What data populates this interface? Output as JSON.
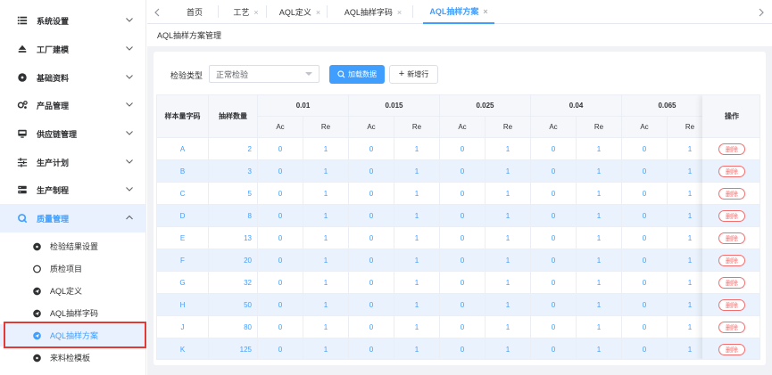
{
  "sidebar": {
    "menus": [
      {
        "label": "系统设置",
        "icon": "list-icon",
        "expanded": false
      },
      {
        "label": "工厂建模",
        "icon": "eject-icon",
        "expanded": false
      },
      {
        "label": "基础资料",
        "icon": "disc-icon",
        "expanded": false
      },
      {
        "label": "产品管理",
        "icon": "gears-icon",
        "expanded": false
      },
      {
        "label": "供应链管理",
        "icon": "monitor-icon",
        "expanded": false
      },
      {
        "label": "生产计划",
        "icon": "sliders-icon",
        "expanded": false
      },
      {
        "label": "生产制程",
        "icon": "server-icon",
        "expanded": false
      },
      {
        "label": "质量管理",
        "icon": "q-icon",
        "expanded": true
      }
    ],
    "sub_items": [
      {
        "label": "检验结果设置",
        "icon": "disc-icon",
        "active": false
      },
      {
        "label": "质检项目",
        "icon": "ring-icon",
        "active": false
      },
      {
        "label": "AQL定义",
        "icon": "send-icon",
        "active": false
      },
      {
        "label": "AQL抽样字码",
        "icon": "send-icon",
        "active": false
      },
      {
        "label": "AQL抽样方案",
        "icon": "send-icon",
        "active": true
      },
      {
        "label": "来料检模板",
        "icon": "disc-icon",
        "active": false
      }
    ]
  },
  "tabs": [
    {
      "label": "首页",
      "closable": false,
      "active": false
    },
    {
      "label": "工艺",
      "closable": true,
      "active": false
    },
    {
      "label": "AQL定义",
      "closable": true,
      "active": false
    },
    {
      "label": "AQL抽样字码",
      "closable": true,
      "active": false
    },
    {
      "label": "AQL抽样方案",
      "closable": true,
      "active": true
    }
  ],
  "breadcrumb": "AQL抽样方案管理",
  "filter": {
    "label": "检验类型",
    "value": "正常检验",
    "load_button": "加载数据",
    "add_button": "新增行"
  },
  "table": {
    "col_sample_code": "样本量字码",
    "col_sample_size": "抽样数量",
    "aql_levels": [
      "0.01",
      "0.015",
      "0.025",
      "0.04",
      "0.065"
    ],
    "ac": "Ac",
    "re": "Re",
    "col_op": "操作",
    "delete_label": "删除",
    "rows": [
      {
        "code": "A",
        "size": "2",
        "ac": "0",
        "re": "1"
      },
      {
        "code": "B",
        "size": "3",
        "ac": "0",
        "re": "1"
      },
      {
        "code": "C",
        "size": "5",
        "ac": "0",
        "re": "1"
      },
      {
        "code": "D",
        "size": "8",
        "ac": "0",
        "re": "1"
      },
      {
        "code": "E",
        "size": "13",
        "ac": "0",
        "re": "1"
      },
      {
        "code": "F",
        "size": "20",
        "ac": "0",
        "re": "1"
      },
      {
        "code": "G",
        "size": "32",
        "ac": "0",
        "re": "1"
      },
      {
        "code": "H",
        "size": "50",
        "ac": "0",
        "re": "1"
      },
      {
        "code": "J",
        "size": "80",
        "ac": "0",
        "re": "1"
      },
      {
        "code": "K",
        "size": "125",
        "ac": "0",
        "re": "1"
      }
    ]
  },
  "colors": {
    "accent": "#409eff",
    "danger": "#f56c6c",
    "highlight_box": "#e53935",
    "row_alt": "#eaf2fd"
  }
}
